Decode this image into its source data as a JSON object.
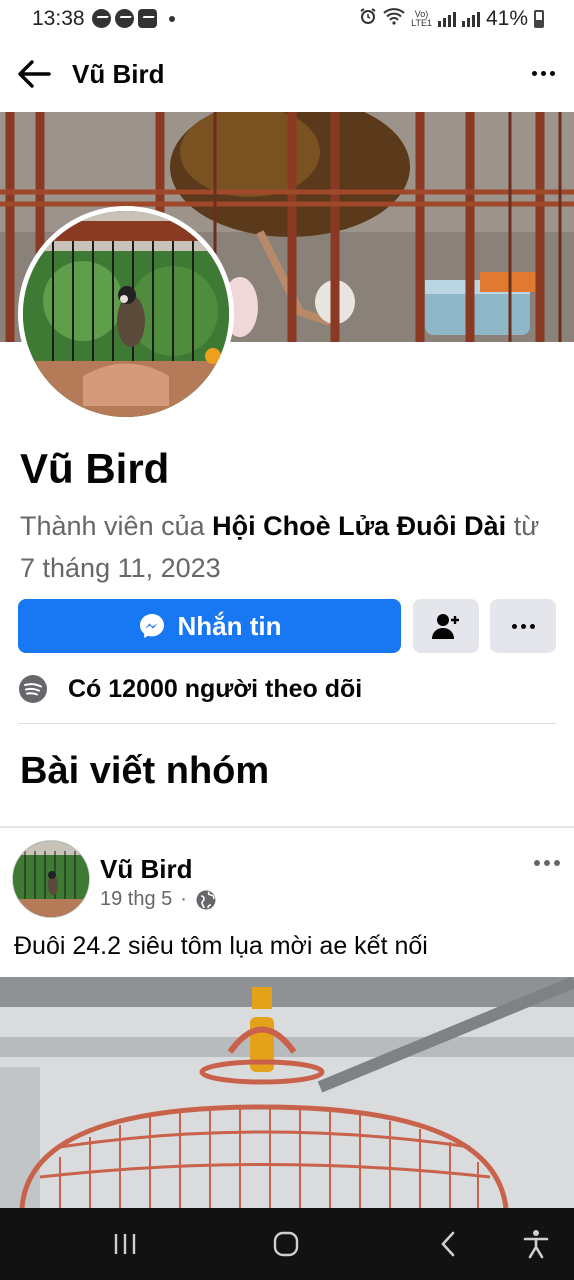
{
  "status_bar": {
    "time": "13:38",
    "network_label_top": "Vo)",
    "network_label_bottom": "LTE1",
    "battery": "41%"
  },
  "header": {
    "title": "Vũ Bird"
  },
  "profile": {
    "name": "Vũ Bird",
    "member_prefix": "Thành viên của ",
    "group_name": "Hội Choè Lửa Đuôi Dài",
    "member_suffix": " từ 7 tháng 11, 2023",
    "message_button": "Nhắn tin",
    "followers_text": "Có 12000 người theo dõi"
  },
  "section": {
    "title": "Bài viết nhóm"
  },
  "post": {
    "author": "Vũ Bird",
    "date": "19 thg 5",
    "separator": "·",
    "text": "Đuôi 24.2 siêu tôm lụa mời ae kết nối"
  },
  "colors": {
    "primary": "#1877f2",
    "secondary_button": "#e4e6eb",
    "meta_text": "#65676b"
  },
  "icons": [
    "back-arrow-icon",
    "more-icon",
    "messenger-icon",
    "add-friend-icon",
    "spotify-icon",
    "globe-icon",
    "recent-apps-icon",
    "home-icon",
    "back-icon",
    "accessibility-icon"
  ]
}
